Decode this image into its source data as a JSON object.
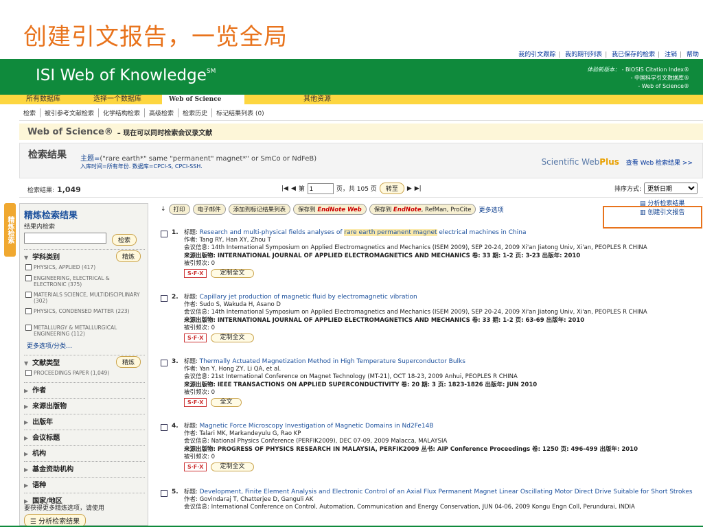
{
  "slide_title": "创建引文报告，一览全局",
  "top_links": [
    "我的引文跟踪",
    "我的期刊列表",
    "我已保存的检索",
    "注销",
    "帮助"
  ],
  "banner": {
    "logo": "ISI Web of Knowledge",
    "logo_sup": "SM",
    "subs_label": "体验新版本：",
    "subs": [
      "- BIOSIS Citation Index®",
      "- 中国科学引文数据库®",
      "- Web of Science®"
    ]
  },
  "tabs": [
    "所有数据库",
    "选择一个数据库",
    "Web of Science",
    "其他资源"
  ],
  "subnav": [
    "检索",
    "被引参考文献检索",
    "化学结构检索",
    "高级检索",
    "检索历史",
    "标记结果列表 (0)"
  ],
  "wos_bar": {
    "title": "Web of Science®",
    "note": "– 现在可以同时检索会议录文献"
  },
  "results_box": {
    "title": "检索结果",
    "query_label": "主题=",
    "query": "(\"rare earth*\" same \"permanent\" magnet*\" or SmCo or NdFeB)",
    "meta": "入库时间=所有年份. 数据库=CPCI-S, CPCI-SSH.",
    "webplus_a": "Scientific Web",
    "webplus_b": "Plus",
    "webplus_link": "查看 Web 检索结果 >>"
  },
  "count_row": {
    "label": "检索结果:",
    "count": "1,049",
    "page_prefix": "第",
    "page_value": "1",
    "page_suffix": "页，共 105 页",
    "goto": "转至",
    "sort_label": "排序方式:",
    "sort_value": "更新日期"
  },
  "side_tab": "精炼检索",
  "sidebar": {
    "title": "精炼检索结果",
    "within": "结果内检索",
    "search_btn": "检索",
    "refine_btn": "精炼",
    "subject_header": "学科类别",
    "subjects": [
      "PHYSICS, APPLIED (417)",
      "ENGINEERING, ELECTRICAL & ELECTRONIC (375)",
      "MATERIALS SCIENCE, MULTIDISCIPLINARY (302)",
      "PHYSICS, CONDENSED MATTER (223)",
      "METALLURGY & METALLURGICAL ENGINEERING (112)"
    ],
    "more_options": "更多选项/分类…",
    "doctype_header": "文献类型",
    "doctypes": [
      "PROCEEDINGS PAPER (1,049)"
    ],
    "collapsed": [
      "作者",
      "来源出版物",
      "出版年",
      "会议标题",
      "机构",
      "基金资助机构",
      "语种",
      "国家/地区"
    ],
    "footer": "要获得更多精炼选项，请使用",
    "analyze": "分析检索结果"
  },
  "toolbar": {
    "print": "打印",
    "email": "电子邮件",
    "add_marked": "添加到标记结果列表",
    "save_to": "保存到",
    "endnote_web": "EndNote Web",
    "endnote": "EndNote",
    "refman": ", RefMan, ProCite",
    "more": "更多选项"
  },
  "right_links": [
    "分析检索结果",
    "创建引文报告"
  ],
  "records": [
    {
      "num": "1.",
      "title_label": "标题:",
      "title_parts": [
        "Research and multi-physical fields analyses of ",
        "rare earth permanent magnet",
        " electrical machines in China"
      ],
      "authors": "作者: Tang RY, Han XY, Zhou T",
      "conf": "会议信息: 14th International Symposium on Applied Electromagnetics and Mechanics (ISEM 2009), SEP 20-24, 2009 Xi'an Jiatong Univ, Xi'an, PEOPLES R CHINA",
      "source": "来源出版物: INTERNATIONAL JOURNAL OF APPLIED ELECTROMAGNETICS AND MECHANICS  卷: 33  期: 1-2  页: 3-23  出版年: 2010",
      "cited": "被引频次: 0",
      "fulltext": "定制全文"
    },
    {
      "num": "2.",
      "title_label": "标题:",
      "title_parts": [
        "Capillary jet production of magnetic fluid by electromagnetic vibration",
        "",
        ""
      ],
      "authors": "作者: Sudo S, Wakuda H, Asano D",
      "conf": "会议信息: 14th International Symposium on Applied Electromagnetics and Mechanics (ISEM 2009), SEP 20-24, 2009 Xi'an Jiatong Univ, Xi'an, PEOPLES R CHINA",
      "source": "来源出版物: INTERNATIONAL JOURNAL OF APPLIED ELECTROMAGNETICS AND MECHANICS  卷: 33  期: 1-2  页: 63-69  出版年: 2010",
      "cited": "被引频次: 0",
      "fulltext": "定制全文"
    },
    {
      "num": "3.",
      "title_label": "标题:",
      "title_parts": [
        "Thermally Actuated Magnetization Method in High Temperature Superconductor Bulks",
        "",
        ""
      ],
      "authors": "作者: Yan Y, Hong ZY, Li QA, et al.",
      "conf": "会议信息: 21st International Conference on Magnet Technology (MT-21), OCT 18-23, 2009 Anhui, PEOPLES R CHINA",
      "source": "来源出版物: IEEE TRANSACTIONS ON APPLIED SUPERCONDUCTIVITY  卷: 20  期: 3  页: 1823-1826  出版年: JUN 2010",
      "cited": "被引频次: 0",
      "fulltext": "全文"
    },
    {
      "num": "4.",
      "title_label": "标题:",
      "title_parts": [
        "Magnetic Force Microscopy Investigation of Magnetic Domains in Nd2Fe14B",
        "",
        ""
      ],
      "authors": "作者: Talari MK, Markandeyulu G, Rao KP",
      "conf": "会议信息: National Physics Conference (PERFIK2009), DEC 07-09, 2009 Malacca, MALAYSIA",
      "source": "来源出版物: PROGRESS OF PHYSICS RESEARCH IN MALAYSIA, PERFIK2009  丛书: AIP Conference Proceedings  卷: 1250  页: 496-499  出版年: 2010",
      "cited": "被引频次: 0",
      "fulltext": "定制全文"
    },
    {
      "num": "5.",
      "title_label": "标题:",
      "title_parts": [
        "Development, Finite Element Analysis and Electronic Control of an Axial Flux Permanent Magnet Linear Oscillating Motor Direct Drive Suitable for Short Strokes",
        "",
        ""
      ],
      "authors": "作者: Govindaraj T, Chatterjee D, Ganguli AK",
      "conf": "会议信息: International Conference on Control, Automation, Communication and Energy Conservation, JUN 04-06, 2009 Kongu Engn Coll, Perundurai, INDIA",
      "source": "",
      "cited": "",
      "fulltext": ""
    }
  ],
  "sfx_label": "S·F·X",
  "colors": {
    "accent": "#e8731c",
    "banner": "#0f8a3c",
    "tabbar": "#fdd640",
    "link": "#1a4f9c"
  }
}
